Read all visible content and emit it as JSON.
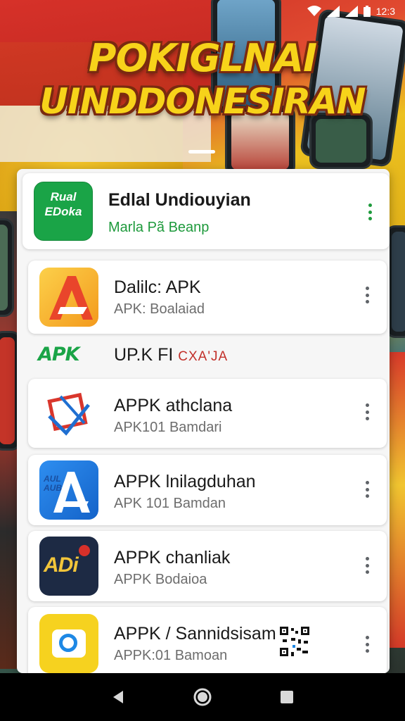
{
  "status_bar": {
    "time": "12:3"
  },
  "hero": {
    "title_line1": "POKIGLNAI",
    "title_line2": "UINDDONESIRAN"
  },
  "featured": {
    "title": "Edlal Undiouyian",
    "subtitle": "Marla Pã Beanp",
    "icon_text_line1": "Rual",
    "icon_text_line2": "EDoka",
    "icon_color": "#1aa447"
  },
  "apps": [
    {
      "title": "Dalilc: APK",
      "subtitle": "APK: Boalaiad",
      "icon": "letter-a-icon"
    },
    {
      "title": "APPK athclana",
      "subtitle": "APK101 Bamdari",
      "icon": "square-arrows-icon"
    },
    {
      "title": "APPK lnilagduhan",
      "subtitle": "APK 101 Bamdan",
      "icon": "app-store-icon",
      "icon_text_line1": "AUL",
      "icon_text_line2": "AUB"
    },
    {
      "title": "APPK chanliak",
      "subtitle": "APPK Bodaiоa",
      "icon": "adi-logo-icon",
      "icon_text": "ADi"
    },
    {
      "title": "APPK / Sannidsisam",
      "subtitle": "APPK:01 Bamoan",
      "icon": "yellow-gear-icon"
    }
  ],
  "apk_banner": {
    "logo_text": "APK",
    "text_main": "UP.K FI",
    "text_red": "CXA'JA"
  },
  "colors": {
    "title_yellow": "#f7d31a",
    "green_accent": "#1aa447",
    "red_accent": "#c2302a"
  }
}
